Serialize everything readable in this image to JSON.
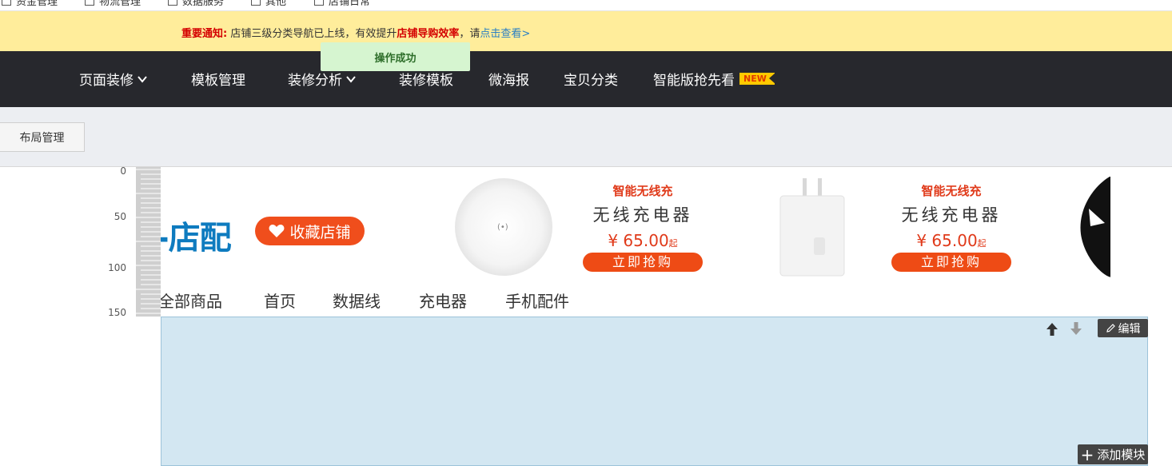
{
  "topbar": {
    "items": [
      "资金管理",
      "物流管理",
      "数据服务",
      "其他",
      "店铺日常"
    ]
  },
  "notice": {
    "label": "重要通知:",
    "text_before": "店铺三级分类导航已上线，有效提升",
    "highlight": "店铺导购效率",
    "text_after": "，请",
    "link": "点击查看>"
  },
  "toast": {
    "text": "操作成功"
  },
  "nav": {
    "items": [
      {
        "label": "页面装修",
        "dropdown": true
      },
      {
        "label": "模板管理",
        "dropdown": false
      },
      {
        "label": "装修分析",
        "dropdown": true
      },
      {
        "label": "装修模板",
        "dropdown": false
      },
      {
        "label": "微海报",
        "dropdown": false
      },
      {
        "label": "宝贝分类",
        "dropdown": false
      },
      {
        "label": "智能版抢先看",
        "dropdown": false,
        "badge": "NEW"
      }
    ]
  },
  "toolbar": {
    "layout_label": "布局管理"
  },
  "ruler": {
    "labels": [
      "0",
      "50",
      "100",
      "150"
    ]
  },
  "banner": {
    "logo_text": "-店配",
    "favorite_label": "收藏店铺",
    "promos": [
      {
        "tag": "智能无线充",
        "title": "无线充电器",
        "price": "¥ 65.00",
        "unit": "起",
        "button": "立即抢购"
      },
      {
        "tag": "智能无线充",
        "title": "无线充电器",
        "price": "¥ 65.00",
        "unit": "起",
        "button": "立即抢购"
      }
    ],
    "shop_nav": [
      "全部商品",
      "首页",
      "数据线",
      "充电器",
      "手机配件"
    ]
  },
  "module": {
    "edit_label": "编辑",
    "add_label": "添加模块"
  },
  "colors": {
    "notice_bg": "#ffed9b",
    "nav_bg": "#27282d",
    "accent_red": "#e03a1a",
    "module_bg": "#d3e7f2",
    "toast_bg": "#d6f5d0"
  }
}
